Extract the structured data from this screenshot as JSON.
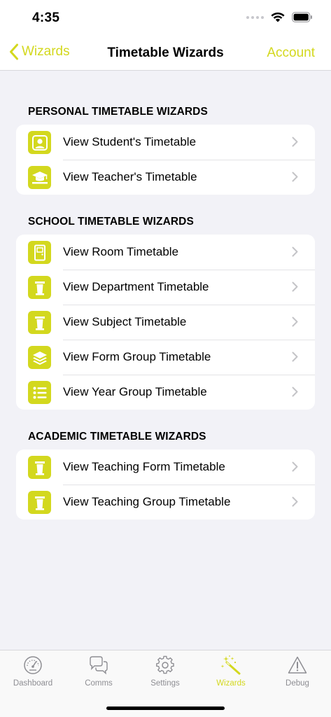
{
  "theme": {
    "accent": "#d3d81e",
    "icon_bg": "#d3d81e",
    "inactive": "#8e8e93",
    "chevron": "#c4c4c7"
  },
  "status": {
    "time": "4:35"
  },
  "nav": {
    "back_label": "Wizards",
    "title": "Timetable Wizards",
    "right_label": "Account"
  },
  "sections": [
    {
      "title": "PERSONAL TIMETABLE WIZARDS",
      "items": [
        {
          "label": "View Student's Timetable",
          "icon": "student-icon"
        },
        {
          "label": "View Teacher's Timetable",
          "icon": "teacher-icon"
        }
      ]
    },
    {
      "title": "SCHOOL TIMETABLE WIZARDS",
      "items": [
        {
          "label": "View Room Timetable",
          "icon": "door-icon"
        },
        {
          "label": "View Department Timetable",
          "icon": "lectern-icon"
        },
        {
          "label": "View Subject Timetable",
          "icon": "lectern-icon"
        },
        {
          "label": "View Form Group Timetable",
          "icon": "layers-icon"
        },
        {
          "label": "View Year Group Timetable",
          "icon": "list-icon"
        }
      ]
    },
    {
      "title": "ACADEMIC TIMETABLE WIZARDS",
      "items": [
        {
          "label": "View Teaching Form Timetable",
          "icon": "lectern-icon"
        },
        {
          "label": "View Teaching Group Timetable",
          "icon": "lectern-icon"
        }
      ]
    }
  ],
  "tabs": [
    {
      "label": "Dashboard",
      "icon": "speedometer-icon",
      "active": false
    },
    {
      "label": "Comms",
      "icon": "chat-bubbles-icon",
      "active": false
    },
    {
      "label": "Settings",
      "icon": "gear-icon",
      "active": false
    },
    {
      "label": "Wizards",
      "icon": "magic-wand-icon",
      "active": true
    },
    {
      "label": "Debug",
      "icon": "warning-icon",
      "active": false
    }
  ]
}
